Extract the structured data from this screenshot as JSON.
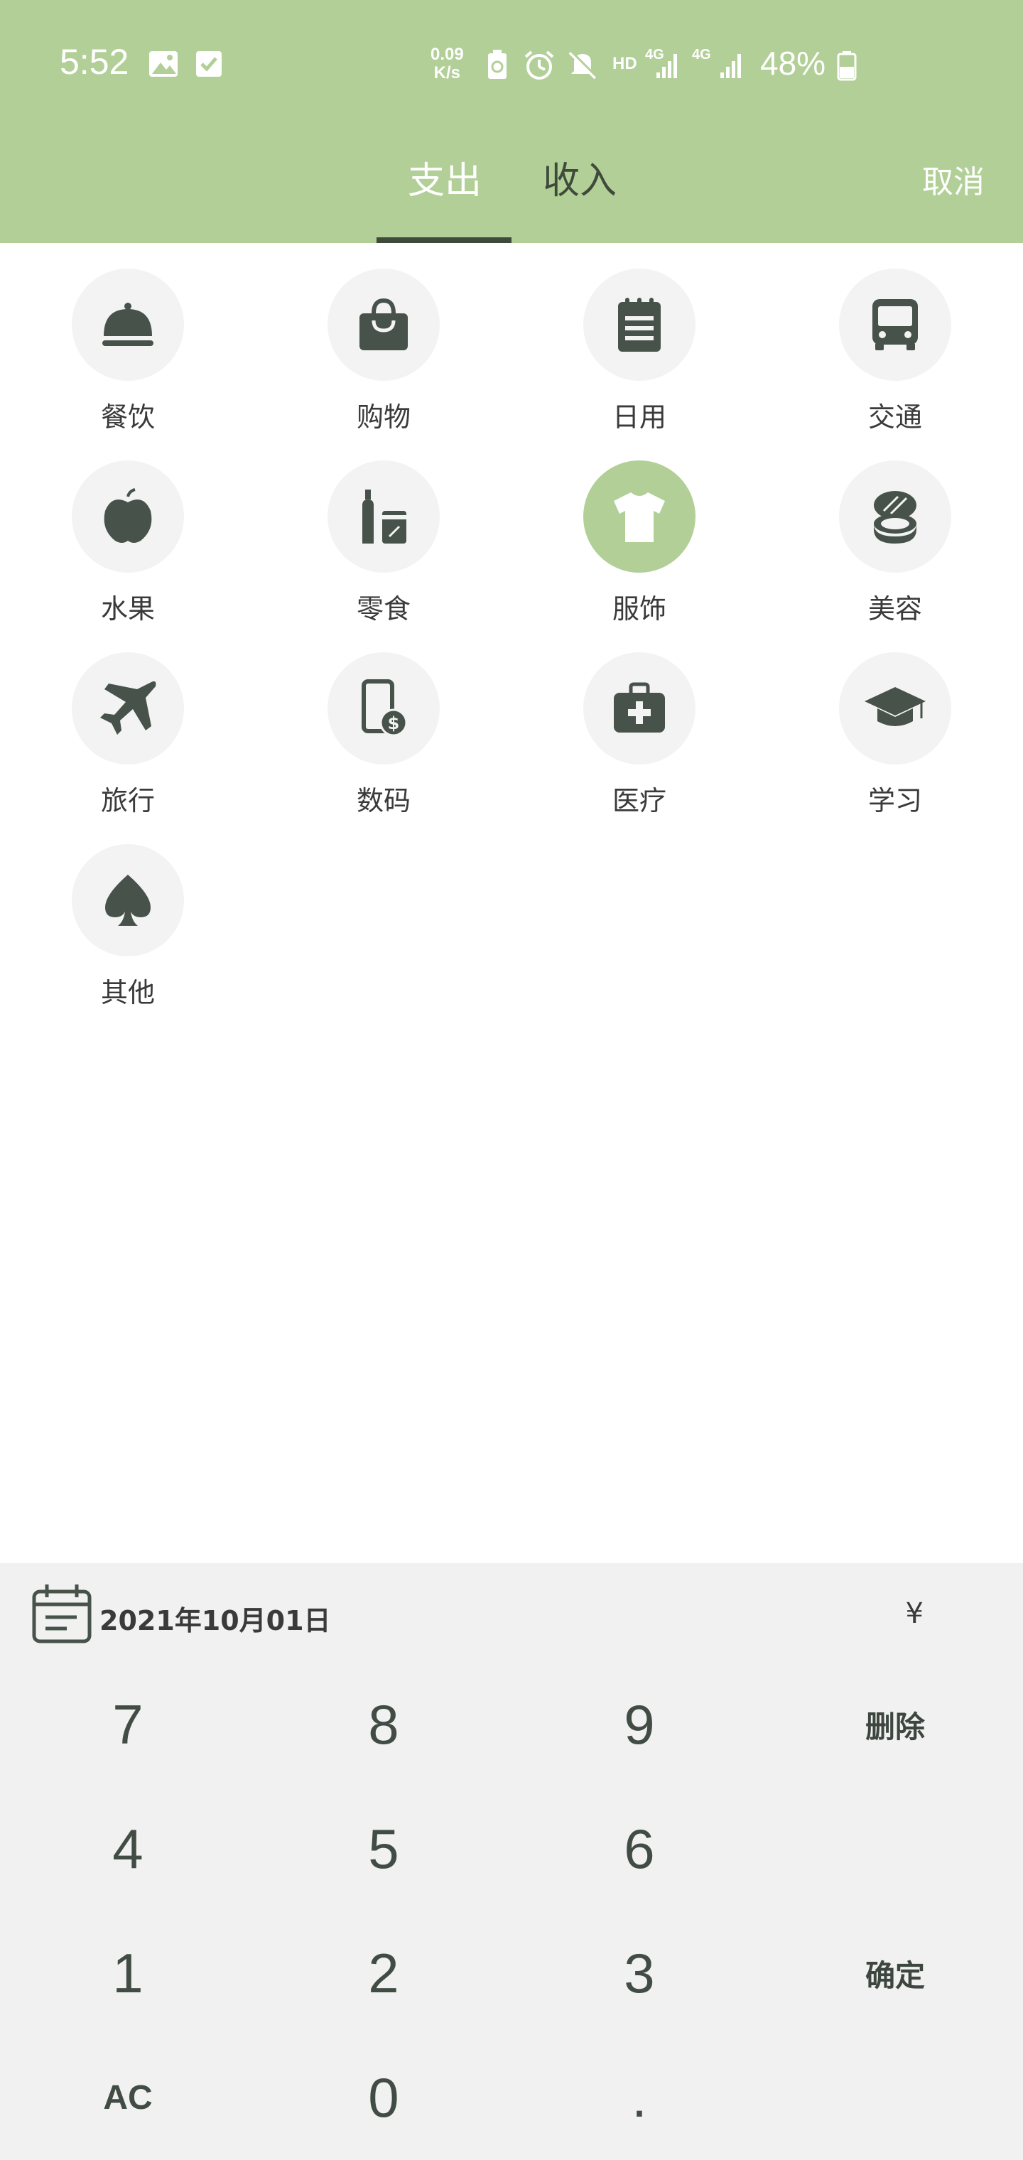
{
  "status_bar": {
    "time": "5:52",
    "net_speed_value": "0.09",
    "net_speed_unit": "K/s",
    "hd": "HD",
    "net1": "4G",
    "net2": "4G",
    "battery": "48%"
  },
  "tabs": {
    "expense": "支出",
    "income": "收入",
    "cancel": "取消"
  },
  "categories": [
    {
      "label": "餐饮",
      "icon": "food-cloche-icon"
    },
    {
      "label": "购物",
      "icon": "shopping-bag-icon"
    },
    {
      "label": "日用",
      "icon": "notepad-icon"
    },
    {
      "label": "交通",
      "icon": "bus-icon"
    },
    {
      "label": "水果",
      "icon": "apple-icon"
    },
    {
      "label": "零食",
      "icon": "snack-bottle-icon"
    },
    {
      "label": "服饰",
      "icon": "tshirt-icon"
    },
    {
      "label": "美容",
      "icon": "makeup-compact-icon"
    },
    {
      "label": "旅行",
      "icon": "airplane-icon"
    },
    {
      "label": "数码",
      "icon": "phone-dollar-icon"
    },
    {
      "label": "医疗",
      "icon": "medical-kit-icon"
    },
    {
      "label": "学习",
      "icon": "graduation-cap-icon"
    },
    {
      "label": "其他",
      "icon": "spade-icon"
    }
  ],
  "selected_category": "服饰",
  "keypad": {
    "date": "2021年10月01日",
    "currency": "¥",
    "k7": "7",
    "k8": "8",
    "k9": "9",
    "delete": "删除",
    "k4": "4",
    "k5": "5",
    "k6": "6",
    "k1": "1",
    "k2": "2",
    "k3": "3",
    "confirm": "确定",
    "ac": "AC",
    "k0": "0",
    "dot": "."
  },
  "colors": {
    "accent": "#b2cf98",
    "icon_dark": "#47524a",
    "circle_bg": "#f3f3f3",
    "keypad_bg": "#f1f1f1"
  }
}
